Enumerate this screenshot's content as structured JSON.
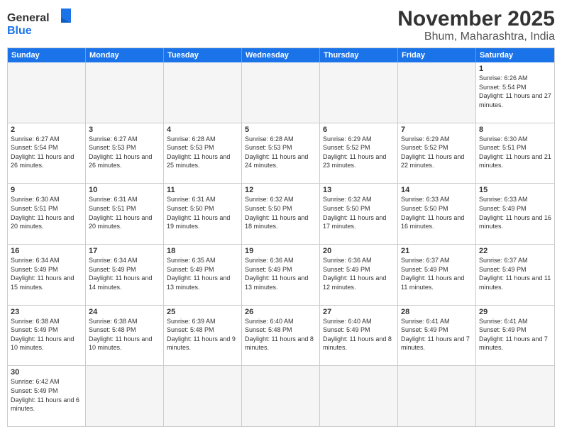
{
  "header": {
    "logo_general": "General",
    "logo_blue": "Blue",
    "month": "November 2025",
    "location": "Bhum, Maharashtra, India"
  },
  "days_of_week": [
    "Sunday",
    "Monday",
    "Tuesday",
    "Wednesday",
    "Thursday",
    "Friday",
    "Saturday"
  ],
  "weeks": [
    [
      {
        "day": "",
        "empty": true
      },
      {
        "day": "",
        "empty": true
      },
      {
        "day": "",
        "empty": true
      },
      {
        "day": "",
        "empty": true
      },
      {
        "day": "",
        "empty": true
      },
      {
        "day": "",
        "empty": true
      },
      {
        "day": "1",
        "sunrise": "6:26 AM",
        "sunset": "5:54 PM",
        "daylight": "11 hours and 27 minutes."
      }
    ],
    [
      {
        "day": "2",
        "sunrise": "6:27 AM",
        "sunset": "5:54 PM",
        "daylight": "11 hours and 26 minutes."
      },
      {
        "day": "3",
        "sunrise": "6:27 AM",
        "sunset": "5:53 PM",
        "daylight": "11 hours and 26 minutes."
      },
      {
        "day": "4",
        "sunrise": "6:28 AM",
        "sunset": "5:53 PM",
        "daylight": "11 hours and 25 minutes."
      },
      {
        "day": "5",
        "sunrise": "6:28 AM",
        "sunset": "5:53 PM",
        "daylight": "11 hours and 24 minutes."
      },
      {
        "day": "6",
        "sunrise": "6:29 AM",
        "sunset": "5:52 PM",
        "daylight": "11 hours and 23 minutes."
      },
      {
        "day": "7",
        "sunrise": "6:29 AM",
        "sunset": "5:52 PM",
        "daylight": "11 hours and 22 minutes."
      },
      {
        "day": "8",
        "sunrise": "6:30 AM",
        "sunset": "5:51 PM",
        "daylight": "11 hours and 21 minutes."
      }
    ],
    [
      {
        "day": "9",
        "sunrise": "6:30 AM",
        "sunset": "5:51 PM",
        "daylight": "11 hours and 20 minutes."
      },
      {
        "day": "10",
        "sunrise": "6:31 AM",
        "sunset": "5:51 PM",
        "daylight": "11 hours and 20 minutes."
      },
      {
        "day": "11",
        "sunrise": "6:31 AM",
        "sunset": "5:50 PM",
        "daylight": "11 hours and 19 minutes."
      },
      {
        "day": "12",
        "sunrise": "6:32 AM",
        "sunset": "5:50 PM",
        "daylight": "11 hours and 18 minutes."
      },
      {
        "day": "13",
        "sunrise": "6:32 AM",
        "sunset": "5:50 PM",
        "daylight": "11 hours and 17 minutes."
      },
      {
        "day": "14",
        "sunrise": "6:33 AM",
        "sunset": "5:50 PM",
        "daylight": "11 hours and 16 minutes."
      },
      {
        "day": "15",
        "sunrise": "6:33 AM",
        "sunset": "5:49 PM",
        "daylight": "11 hours and 16 minutes."
      }
    ],
    [
      {
        "day": "16",
        "sunrise": "6:34 AM",
        "sunset": "5:49 PM",
        "daylight": "11 hours and 15 minutes."
      },
      {
        "day": "17",
        "sunrise": "6:34 AM",
        "sunset": "5:49 PM",
        "daylight": "11 hours and 14 minutes."
      },
      {
        "day": "18",
        "sunrise": "6:35 AM",
        "sunset": "5:49 PM",
        "daylight": "11 hours and 13 minutes."
      },
      {
        "day": "19",
        "sunrise": "6:36 AM",
        "sunset": "5:49 PM",
        "daylight": "11 hours and 13 minutes."
      },
      {
        "day": "20",
        "sunrise": "6:36 AM",
        "sunset": "5:49 PM",
        "daylight": "11 hours and 12 minutes."
      },
      {
        "day": "21",
        "sunrise": "6:37 AM",
        "sunset": "5:49 PM",
        "daylight": "11 hours and 11 minutes."
      },
      {
        "day": "22",
        "sunrise": "6:37 AM",
        "sunset": "5:49 PM",
        "daylight": "11 hours and 11 minutes."
      }
    ],
    [
      {
        "day": "23",
        "sunrise": "6:38 AM",
        "sunset": "5:49 PM",
        "daylight": "11 hours and 10 minutes."
      },
      {
        "day": "24",
        "sunrise": "6:38 AM",
        "sunset": "5:48 PM",
        "daylight": "11 hours and 10 minutes."
      },
      {
        "day": "25",
        "sunrise": "6:39 AM",
        "sunset": "5:48 PM",
        "daylight": "11 hours and 9 minutes."
      },
      {
        "day": "26",
        "sunrise": "6:40 AM",
        "sunset": "5:48 PM",
        "daylight": "11 hours and 8 minutes."
      },
      {
        "day": "27",
        "sunrise": "6:40 AM",
        "sunset": "5:49 PM",
        "daylight": "11 hours and 8 minutes."
      },
      {
        "day": "28",
        "sunrise": "6:41 AM",
        "sunset": "5:49 PM",
        "daylight": "11 hours and 7 minutes."
      },
      {
        "day": "29",
        "sunrise": "6:41 AM",
        "sunset": "5:49 PM",
        "daylight": "11 hours and 7 minutes."
      }
    ],
    [
      {
        "day": "30",
        "sunrise": "6:42 AM",
        "sunset": "5:49 PM",
        "daylight": "11 hours and 6 minutes."
      },
      {
        "day": "",
        "empty": true
      },
      {
        "day": "",
        "empty": true
      },
      {
        "day": "",
        "empty": true
      },
      {
        "day": "",
        "empty": true
      },
      {
        "day": "",
        "empty": true
      },
      {
        "day": "",
        "empty": true
      }
    ]
  ],
  "labels": {
    "sunrise": "Sunrise:",
    "sunset": "Sunset:",
    "daylight": "Daylight:"
  }
}
